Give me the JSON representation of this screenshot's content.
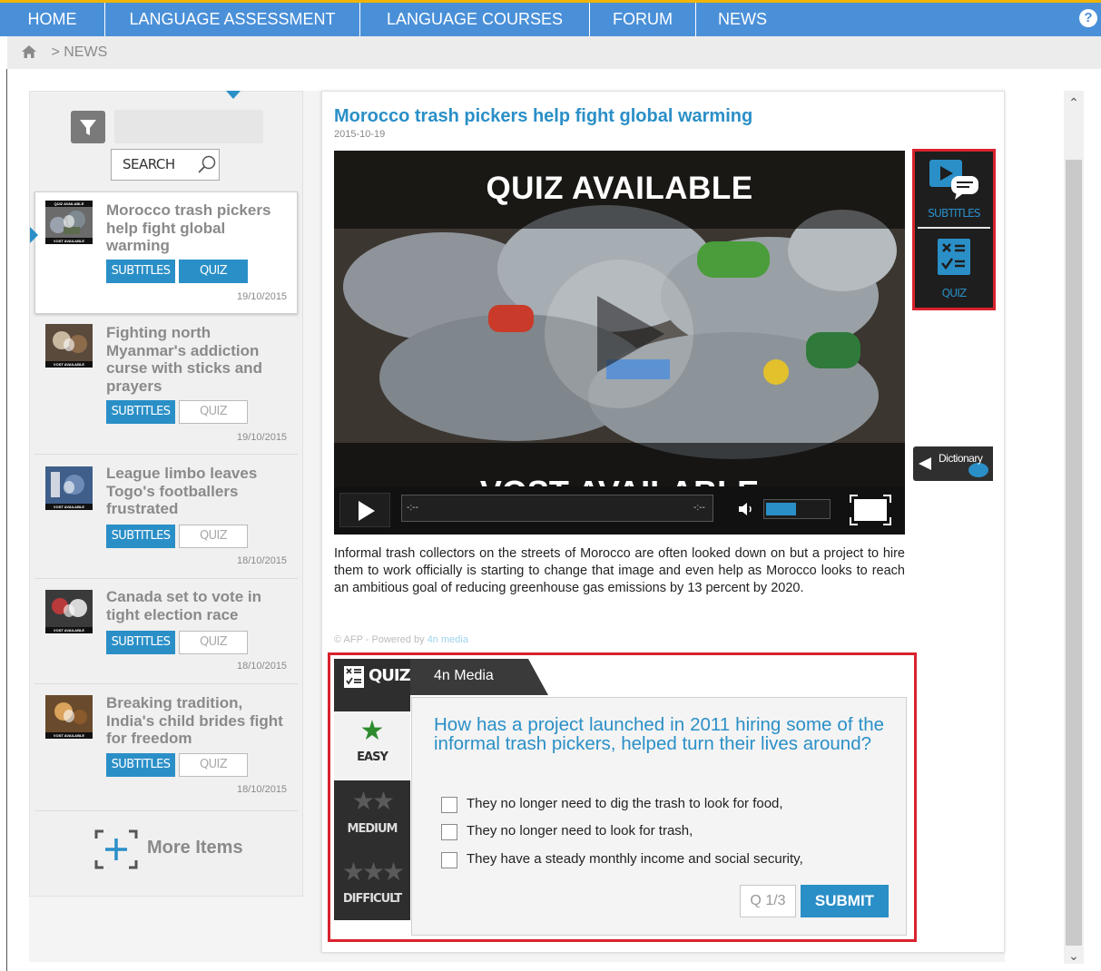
{
  "nav": {
    "items": [
      {
        "label": "HOME"
      },
      {
        "label": "LANGUAGE ASSESSMENT"
      },
      {
        "label": "LANGUAGE COURSES"
      },
      {
        "label": "FORUM"
      },
      {
        "label": "NEWS"
      }
    ],
    "help_label": "?"
  },
  "breadcrumb": {
    "separator": ">",
    "current": "NEWS"
  },
  "sidebar": {
    "search_label": "SEARCH",
    "items": [
      {
        "title": "Morocco trash pickers help fight global warming",
        "subtitles_label": "SUBTITLES",
        "quiz_label": "QUIZ",
        "date": "19/10/2015",
        "quiz_enabled": true,
        "thumb_top": "QUIZ AVAILABLE",
        "thumb_bottom": "VOST AVAILABLE"
      },
      {
        "title": "Fighting north Myanmar's addiction curse with sticks and prayers",
        "subtitles_label": "SUBTITLES",
        "quiz_label": "QUIZ",
        "date": "19/10/2015",
        "quiz_enabled": false,
        "thumb_bottom": "VOST AVAILABLE"
      },
      {
        "title": "League limbo leaves Togo's footballers frustrated",
        "subtitles_label": "SUBTITLES",
        "quiz_label": "QUIZ",
        "date": "18/10/2015",
        "quiz_enabled": false,
        "thumb_bottom": "VOST AVAILABLE"
      },
      {
        "title": "Canada set to vote in tight election race",
        "subtitles_label": "SUBTITLES",
        "quiz_label": "QUIZ",
        "date": "18/10/2015",
        "quiz_enabled": false,
        "thumb_bottom": "VOST AVAILABLE"
      },
      {
        "title": "Breaking tradition, India's child brides fight for freedom",
        "subtitles_label": "SUBTITLES",
        "quiz_label": "QUIZ",
        "date": "18/10/2015",
        "quiz_enabled": false,
        "thumb_bottom": "VOST AVAILABLE"
      }
    ],
    "more_items_label": "More Items"
  },
  "article": {
    "title": "Morocco trash pickers help fight global warming",
    "date": "2015-10-19",
    "video": {
      "top_banner": "QUIZ AVAILABLE",
      "bottom_banner": "VOST AVAILABLE",
      "seek_start": "-:--",
      "seek_end": "-:--",
      "volume_level": 0.5
    },
    "tools": {
      "subtitles_label": "SUBTITLES",
      "quiz_label": "QUIZ"
    },
    "dictionary_label": "Dictionary",
    "body": "Informal trash collectors on the streets of Morocco are often looked down on but a project to hire them to work officially is starting to change that image and even help as Morocco looks to reach an ambitious goal of reducing greenhouse gas emissions by 13 percent by 2020.",
    "credit": "© AFP - Powered by",
    "credit_brand": "4n media"
  },
  "quiz": {
    "tab_label": "QUIZ",
    "source": "4n Media",
    "levels": [
      {
        "label": "EASY",
        "stars": 1,
        "selected": true
      },
      {
        "label": "MEDIUM",
        "stars": 2,
        "selected": false
      },
      {
        "label": "DIFFICULT",
        "stars": 3,
        "selected": false
      }
    ],
    "question": "How has a project launched in 2011 hiring some of the informal trash pickers, helped turn their lives around?",
    "answers": [
      "They no longer need to dig the trash to look for food,",
      "They no longer need to look for trash,",
      "They have a steady monthly income and social security,"
    ],
    "counter": "Q 1/3",
    "submit_label": "SUBMIT"
  },
  "colors": {
    "accent": "#2a8fc7",
    "nav_bg": "#4a90d9",
    "highlight_border": "#d9232e",
    "dark_panel": "#2e2e2e"
  }
}
